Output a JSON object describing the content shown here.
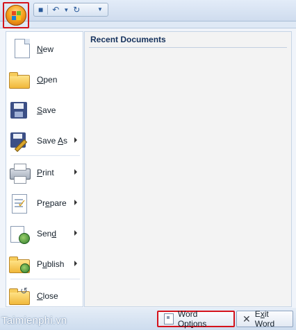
{
  "title_bar": {
    "qat_save_icon": "save-icon",
    "qat_undo_icon": "undo-icon",
    "qat_redo_icon": "redo-icon",
    "qat_dropdown_icon": "dropdown-arrow-icon"
  },
  "office_button": {
    "icon": "office-logo-icon",
    "highlight_color": "#d4121b"
  },
  "menu": {
    "items": [
      {
        "label_prefix": "",
        "label_ul": "N",
        "label_rest": "ew",
        "icon": "new-document-icon",
        "has_submenu": false
      },
      {
        "label_prefix": "",
        "label_ul": "O",
        "label_rest": "pen",
        "icon": "open-folder-icon",
        "has_submenu": false
      },
      {
        "label_prefix": "",
        "label_ul": "S",
        "label_rest": "ave",
        "icon": "save-disk-icon",
        "has_submenu": false
      },
      {
        "label_prefix": "Save ",
        "label_ul": "A",
        "label_rest": "s",
        "icon": "save-as-icon",
        "has_submenu": true
      },
      {
        "label_prefix": "",
        "label_ul": "P",
        "label_rest": "rint",
        "icon": "printer-icon",
        "has_submenu": true
      },
      {
        "label_prefix": "Pr",
        "label_ul": "e",
        "label_rest": "pare",
        "icon": "prepare-icon",
        "has_submenu": true
      },
      {
        "label_prefix": "Sen",
        "label_ul": "d",
        "label_rest": "",
        "icon": "send-icon",
        "has_submenu": true
      },
      {
        "label_prefix": "P",
        "label_ul": "u",
        "label_rest": "blish",
        "icon": "publish-icon",
        "has_submenu": true
      },
      {
        "label_prefix": "",
        "label_ul": "C",
        "label_rest": "lose",
        "icon": "close-folder-icon",
        "has_submenu": false
      }
    ]
  },
  "recent": {
    "title": "Recent Documents"
  },
  "bottom": {
    "word_options": {
      "prefix": "Word Opt",
      "ul": "i",
      "rest": "ons",
      "icon": "options-icon"
    },
    "exit_word": {
      "prefix": "E",
      "ul": "x",
      "rest": "it Word",
      "icon": "close-x-icon"
    },
    "watermark": "Taimienphi.vn"
  }
}
